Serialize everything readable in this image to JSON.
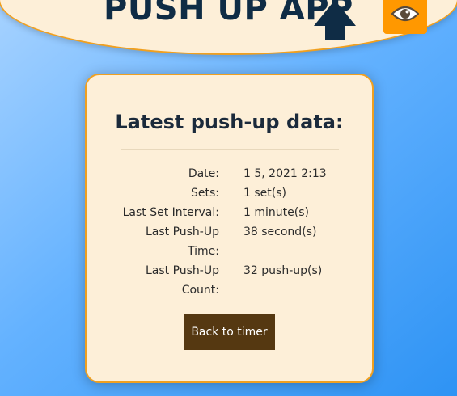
{
  "header": {
    "title": "PUSH UP APP",
    "logo_icon": "up-arrow-icon",
    "toggle_icon": "eye-icon",
    "colors": {
      "background": "#fdefd8",
      "border": "#f0a020",
      "title": "#0f2c45",
      "button": "#ff9800"
    }
  },
  "card": {
    "title": "Latest push-up data:",
    "rows": [
      {
        "label": "Date:",
        "value": "1 5, 2021 2:13"
      },
      {
        "label": "Sets:",
        "value": "1 set(s)"
      },
      {
        "label": "Last Set Interval:",
        "value": "1 minute(s)"
      },
      {
        "label": "Last Push-Up Time:",
        "value": "38 second(s)"
      },
      {
        "label": "Last Push-Up Count:",
        "value": "32 push-up(s)"
      }
    ],
    "back_button_label": "Back to timer",
    "colors": {
      "background": "#fdefd8",
      "border": "#f0a020",
      "button": "#553811"
    }
  },
  "page": {
    "background_gradient": [
      "#a6d2ff",
      "#2e93f4"
    ]
  }
}
